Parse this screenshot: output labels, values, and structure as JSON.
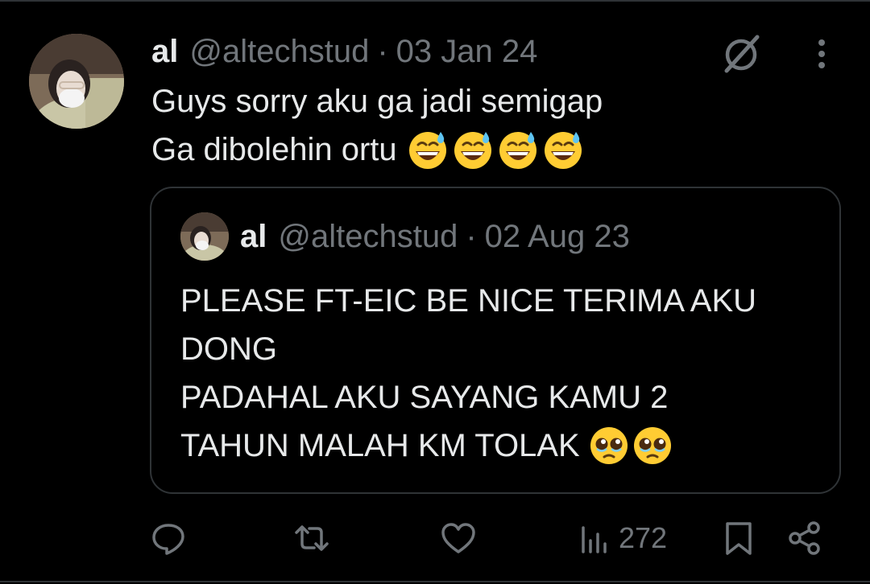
{
  "tweet": {
    "author_name": "al",
    "author_handle": "@altechstud",
    "separator": "·",
    "date": "03 Jan 24",
    "text_line_1": "Guys sorry aku ga jadi semigap",
    "text_line_2": "Ga dibolehin ortu",
    "line_2_emojis": [
      "grinning-face-with-sweat",
      "grinning-face-with-sweat",
      "grinning-face-with-sweat",
      "grinning-face-with-sweat"
    ]
  },
  "quote": {
    "author_name": "al",
    "author_handle": "@altechstud",
    "separator": "·",
    "date": "02 Aug 23",
    "lines": [
      "PLEASE FT-EIC BE NICE TERIMA AKU",
      "DONG",
      "PADAHAL AKU SAYANG KAMU 2",
      "TAHUN MALAH KM TOLAK"
    ],
    "last_line_emojis": [
      "pleading-face",
      "pleading-face"
    ]
  },
  "actions": {
    "views_count": "272"
  },
  "icons": {
    "header": [
      "grok-icon",
      "more-icon"
    ],
    "action_bar": [
      "reply-icon",
      "retweet-icon",
      "like-icon",
      "views-icon",
      "bookmark-icon",
      "share-icon"
    ]
  },
  "colors": {
    "background": "#000000",
    "text_primary": "#e7e9ea",
    "text_secondary": "#71767b",
    "border": "#2f3336"
  }
}
